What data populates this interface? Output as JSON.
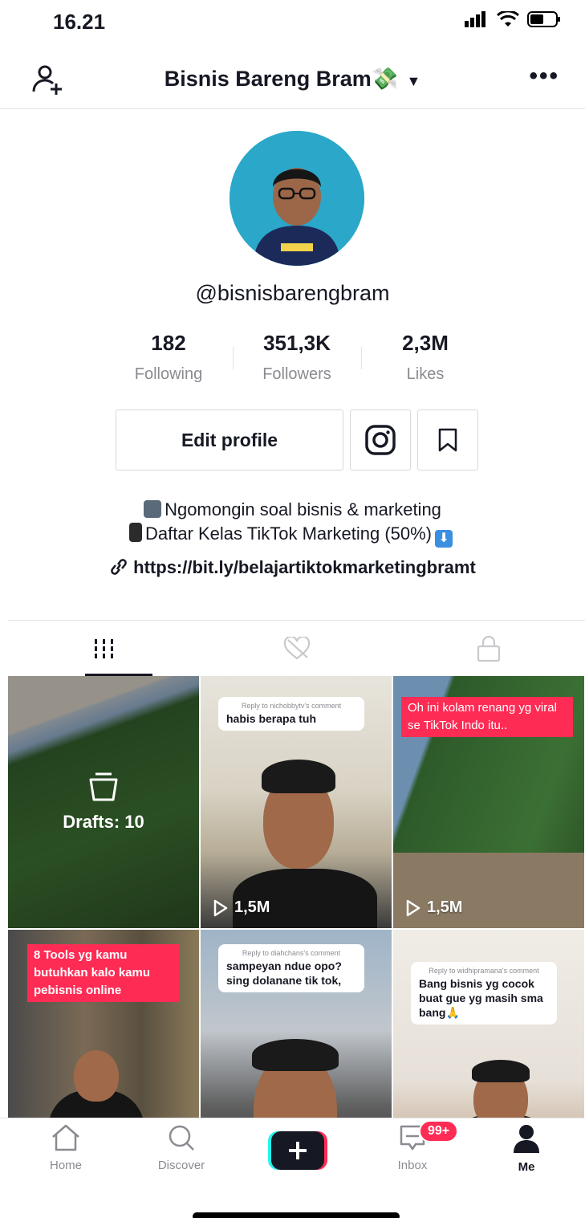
{
  "status_bar": {
    "time": "16.21"
  },
  "header": {
    "title": "Bisnis Bareng Bram💸"
  },
  "profile": {
    "username": "@bisnisbarengbram",
    "stats": [
      {
        "value": "182",
        "label": "Following"
      },
      {
        "value": "351,3K",
        "label": "Followers"
      },
      {
        "value": "2,3M",
        "label": "Likes"
      }
    ],
    "edit_label": "Edit profile",
    "bio_line1": "Ngomongin soal bisnis & marketing",
    "bio_line2": "Daftar Kelas TikTok Marketing (50%)",
    "link": "https://bit.ly/belajartiktokmarketingbramt"
  },
  "videos": [
    {
      "type": "drafts",
      "label": "Drafts: 10"
    },
    {
      "reply_to": "Reply to nichobbytv's comment",
      "reply_text": "habis berapa tuh",
      "views": "1,5M"
    },
    {
      "caption": "Oh ini kolam renang yg viral se TikTok Indo itu..",
      "views": "1,5M"
    },
    {
      "caption": "8 Tools yg kamu butuhkan kalo kamu pebisnis online"
    },
    {
      "reply_to": "Reply to diahchans's comment",
      "reply_text": "sampeyan ndue opo? sing dolanane tik tok,"
    },
    {
      "reply_to": "Reply to widhipramana's comment",
      "reply_text": "Bang bisnis yg cocok buat gue yg masih sma bang🙏"
    }
  ],
  "tabbar": {
    "home": "Home",
    "discover": "Discover",
    "inbox": "Inbox",
    "inbox_badge": "99+",
    "me": "Me"
  }
}
